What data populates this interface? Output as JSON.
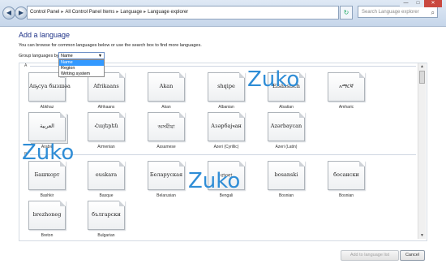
{
  "address": {
    "crumbs": [
      "Control Panel",
      "All Control Panel Items",
      "Language",
      "Language explorer"
    ],
    "search_placeholder": "Search Language explorer"
  },
  "window_controls": {
    "minimize": "—",
    "maximize": "□",
    "close": "✕"
  },
  "heading": "Add a language",
  "subtitle": "You can browse for common languages below or use the search box to find more languages.",
  "group_by": {
    "label": "Group languages by:",
    "selected": "Name",
    "options": [
      "Name",
      "Region",
      "Writing system"
    ]
  },
  "groups": [
    {
      "letter": "A"
    },
    {
      "letter": "B"
    }
  ],
  "languages_a": [
    {
      "sample": "Аҧсуа бызшәа",
      "name": "Abkhaz"
    },
    {
      "sample": "Afrikaans",
      "name": "Afrikaans"
    },
    {
      "sample": "Akan",
      "name": "Akan"
    },
    {
      "sample": "shqipe",
      "name": "Albanian"
    },
    {
      "sample": "Elsässisch",
      "name": "Alsatian"
    },
    {
      "sample": "አማርኛ",
      "name": "Amharic"
    },
    {
      "sample": "العربية",
      "name": "Arabic"
    },
    {
      "sample": "Հայերեն",
      "name": "Armenian"
    },
    {
      "sample": "অসমীয়া",
      "name": "Assamese"
    },
    {
      "sample": "Азәрбајҹан",
      "name": "Azeri (Cyrillic)"
    },
    {
      "sample": "Azərbaycan",
      "name": "Azeri (Latin)"
    }
  ],
  "languages_b": [
    {
      "sample": "Башҡорт",
      "name": "Bashkir"
    },
    {
      "sample": "euskara",
      "name": "Basque"
    },
    {
      "sample": "Беларуская",
      "name": "Belarusian"
    },
    {
      "sample": "বাংলা",
      "name": "Bengali"
    },
    {
      "sample": "bosanski",
      "name": "Bosnian"
    },
    {
      "sample": "босански",
      "name": "Bosnian"
    },
    {
      "sample": "brezhoneg",
      "name": "Breton"
    },
    {
      "sample": "български",
      "name": "Bulgarian"
    }
  ],
  "watermark_text": "Zuko",
  "buttons": {
    "add": "Add to language list",
    "cancel": "Cancel"
  }
}
